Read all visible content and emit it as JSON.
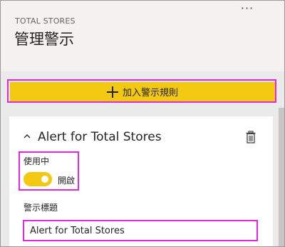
{
  "header": {
    "more_label": "···",
    "subtitle": "TOTAL STORES",
    "title": "管理警示"
  },
  "add_rule": {
    "label": "加入警示規則",
    "icon": "plus-icon"
  },
  "alert_card": {
    "name": "Alert for Total Stores",
    "collapse_icon": "chevron-up-icon",
    "delete_icon": "trash-icon",
    "active": {
      "label": "使用中",
      "state_text": "開啟",
      "on": true
    },
    "alert_title": {
      "label": "警示標題",
      "value": "Alert for Total Stores"
    }
  },
  "colors": {
    "accent": "#f2c811",
    "highlight": "#e625e0",
    "header_bg": "#f3f2f1",
    "panel_bg": "#eaeaea",
    "card_bg": "#ffffff"
  }
}
